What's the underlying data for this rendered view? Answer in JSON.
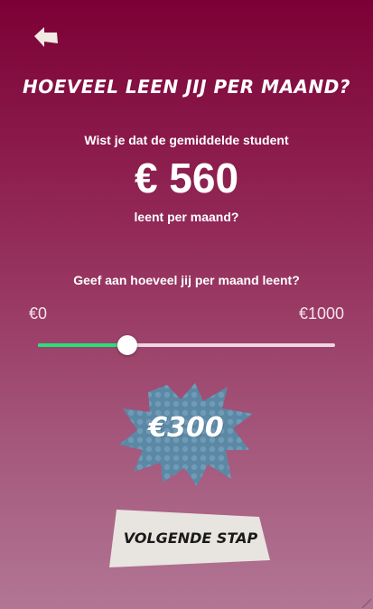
{
  "header": {
    "back_icon": "back-arrow-icon",
    "title": "HOEVEEL LEEN JIJ PER MAAND?"
  },
  "info": {
    "intro": "Wist je dat de gemiddelde student",
    "amount": "€ 560",
    "outro": "leent per maand?"
  },
  "slider": {
    "question": "Geef aan hoeveel jij per maand leent?",
    "min_label": "€0",
    "max_label": "€1000",
    "min": 0,
    "max": 1000,
    "value": 300,
    "value_label": "€300"
  },
  "actions": {
    "next_label": "VOLGENDE STAP"
  },
  "colors": {
    "background_top": "#7c0035",
    "background_bottom": "#b27695",
    "slider_fill": "#27e07a",
    "slider_track": "#efd6e2",
    "burst": "#5b88a5",
    "button": "#e8e4df"
  }
}
